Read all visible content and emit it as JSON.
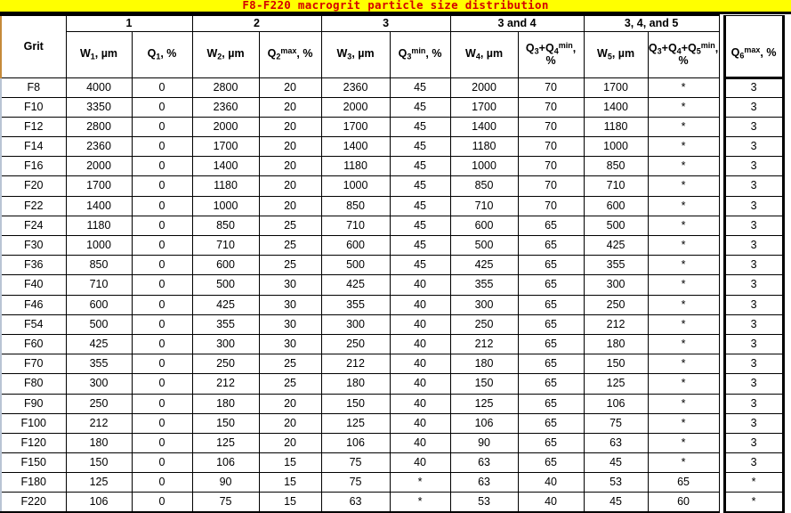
{
  "title": {
    "text": "F8-F220 macrogrit particle size distribution",
    "background_color": "#ffff00",
    "text_color": "#d40000"
  },
  "table": {
    "corner_header": "Grit",
    "group_headers": [
      {
        "label": "1",
        "span": 2
      },
      {
        "label": "2",
        "span": 2
      },
      {
        "label": "3",
        "span": 2
      },
      {
        "label": "3 and 4",
        "span": 2
      },
      {
        "label": "3, 4, and 5",
        "span": 2
      },
      {
        "label": "",
        "span": 1
      }
    ],
    "columns": [
      {
        "base": "W",
        "sub": "1",
        "sup": "",
        "unit": ", µm"
      },
      {
        "base": "Q",
        "sub": "1",
        "sup": "",
        "unit": ", %"
      },
      {
        "base": "W",
        "sub": "2",
        "sup": "",
        "unit": ", µm"
      },
      {
        "base": "Q",
        "sub": "2",
        "sup": "max",
        "unit": ", %"
      },
      {
        "base": "W",
        "sub": "3",
        "sup": "",
        "unit": ", µm"
      },
      {
        "base": "Q",
        "sub": "3",
        "sup": "min",
        "unit": ", %"
      },
      {
        "base": "W",
        "sub": "4",
        "sup": "",
        "unit": ", µm"
      },
      {
        "base": "Q",
        "sub": "3",
        "sup": "",
        "unit": "",
        "compound": "Q3+Q4min"
      },
      {
        "base": "W",
        "sub": "5",
        "sup": "",
        "unit": ", µm"
      },
      {
        "base": "Q",
        "sub": "3",
        "sup": "",
        "unit": "",
        "compound": "Q3+Q4+Q5min"
      },
      {
        "base": "Q",
        "sub": "6",
        "sup": "max",
        "unit": ", %"
      }
    ],
    "column_labels_plain": [
      "W1, µm",
      "Q1, %",
      "W2, µm",
      "Q2max, %",
      "W3, µm",
      "Q3min, %",
      "W4, µm",
      "Q3+Q4min, %",
      "W5, µm",
      "Q3+Q4+Q5min, %",
      "Q6max, %"
    ],
    "rows": [
      {
        "grit": "F8",
        "values": [
          "4000",
          "0",
          "2800",
          "20",
          "2360",
          "45",
          "2000",
          "70",
          "1700",
          "*",
          "3"
        ]
      },
      {
        "grit": "F10",
        "values": [
          "3350",
          "0",
          "2360",
          "20",
          "2000",
          "45",
          "1700",
          "70",
          "1400",
          "*",
          "3"
        ]
      },
      {
        "grit": "F12",
        "values": [
          "2800",
          "0",
          "2000",
          "20",
          "1700",
          "45",
          "1400",
          "70",
          "1180",
          "*",
          "3"
        ]
      },
      {
        "grit": "F14",
        "values": [
          "2360",
          "0",
          "1700",
          "20",
          "1400",
          "45",
          "1180",
          "70",
          "1000",
          "*",
          "3"
        ]
      },
      {
        "grit": "F16",
        "values": [
          "2000",
          "0",
          "1400",
          "20",
          "1180",
          "45",
          "1000",
          "70",
          "850",
          "*",
          "3"
        ]
      },
      {
        "grit": "F20",
        "values": [
          "1700",
          "0",
          "1180",
          "20",
          "1000",
          "45",
          "850",
          "70",
          "710",
          "*",
          "3"
        ]
      },
      {
        "grit": "F22",
        "values": [
          "1400",
          "0",
          "1000",
          "20",
          "850",
          "45",
          "710",
          "70",
          "600",
          "*",
          "3"
        ]
      },
      {
        "grit": "F24",
        "values": [
          "1180",
          "0",
          "850",
          "25",
          "710",
          "45",
          "600",
          "65",
          "500",
          "*",
          "3"
        ]
      },
      {
        "grit": "F30",
        "values": [
          "1000",
          "0",
          "710",
          "25",
          "600",
          "45",
          "500",
          "65",
          "425",
          "*",
          "3"
        ]
      },
      {
        "grit": "F36",
        "values": [
          "850",
          "0",
          "600",
          "25",
          "500",
          "45",
          "425",
          "65",
          "355",
          "*",
          "3"
        ]
      },
      {
        "grit": "F40",
        "values": [
          "710",
          "0",
          "500",
          "30",
          "425",
          "40",
          "355",
          "65",
          "300",
          "*",
          "3"
        ]
      },
      {
        "grit": "F46",
        "values": [
          "600",
          "0",
          "425",
          "30",
          "355",
          "40",
          "300",
          "65",
          "250",
          "*",
          "3"
        ]
      },
      {
        "grit": "F54",
        "values": [
          "500",
          "0",
          "355",
          "30",
          "300",
          "40",
          "250",
          "65",
          "212",
          "*",
          "3"
        ]
      },
      {
        "grit": "F60",
        "values": [
          "425",
          "0",
          "300",
          "30",
          "250",
          "40",
          "212",
          "65",
          "180",
          "*",
          "3"
        ]
      },
      {
        "grit": "F70",
        "values": [
          "355",
          "0",
          "250",
          "25",
          "212",
          "40",
          "180",
          "65",
          "150",
          "*",
          "3"
        ]
      },
      {
        "grit": "F80",
        "values": [
          "300",
          "0",
          "212",
          "25",
          "180",
          "40",
          "150",
          "65",
          "125",
          "*",
          "3"
        ]
      },
      {
        "grit": "F90",
        "values": [
          "250",
          "0",
          "180",
          "20",
          "150",
          "40",
          "125",
          "65",
          "106",
          "*",
          "3"
        ]
      },
      {
        "grit": "F100",
        "values": [
          "212",
          "0",
          "150",
          "20",
          "125",
          "40",
          "106",
          "65",
          "75",
          "*",
          "3"
        ]
      },
      {
        "grit": "F120",
        "values": [
          "180",
          "0",
          "125",
          "20",
          "106",
          "40",
          "90",
          "65",
          "63",
          "*",
          "3"
        ]
      },
      {
        "grit": "F150",
        "values": [
          "150",
          "0",
          "106",
          "15",
          "75",
          "40",
          "63",
          "65",
          "45",
          "*",
          "3"
        ]
      },
      {
        "grit": "F180",
        "values": [
          "125",
          "0",
          "90",
          "15",
          "75",
          "*",
          "63",
          "40",
          "53",
          "65",
          "*"
        ]
      },
      {
        "grit": "F220",
        "values": [
          "106",
          "0",
          "75",
          "15",
          "63",
          "*",
          "53",
          "40",
          "45",
          "60",
          "*"
        ]
      }
    ]
  }
}
